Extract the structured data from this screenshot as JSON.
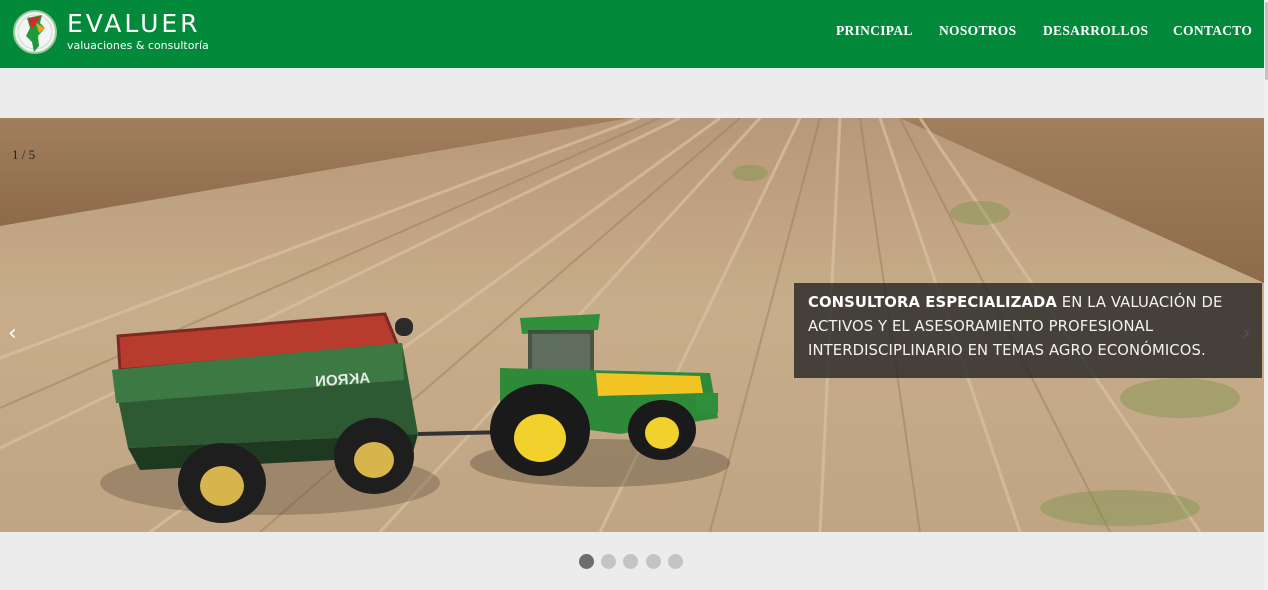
{
  "header": {
    "brand": "EVALUER",
    "tagline": "valuaciones & consultoría",
    "colors": {
      "bar": "#028a3a",
      "text": "#ffffff"
    }
  },
  "nav": {
    "items": [
      {
        "label": "PRINCIPAL"
      },
      {
        "label": "NOSOTROS"
      },
      {
        "label": "DESARROLLOS"
      },
      {
        "label": "CONTACTO"
      }
    ]
  },
  "slider": {
    "counter": "1 / 5",
    "prev_icon": "‹",
    "next_icon": "›",
    "caption": {
      "bold": "CONSULTORA ESPECIALIZADA",
      "rest": " EN LA VALUACIÓN DE ACTIVOS Y EL ASESORAMIENTO PROFESIONAL INTERDISCIPLINARIO EN TEMAS AGRO ECONÓMICOS."
    },
    "image": "field-with-tractor-and-grain-cart",
    "dots": {
      "count": 5,
      "active_index": 0
    },
    "trailer_text": "AKRON"
  }
}
